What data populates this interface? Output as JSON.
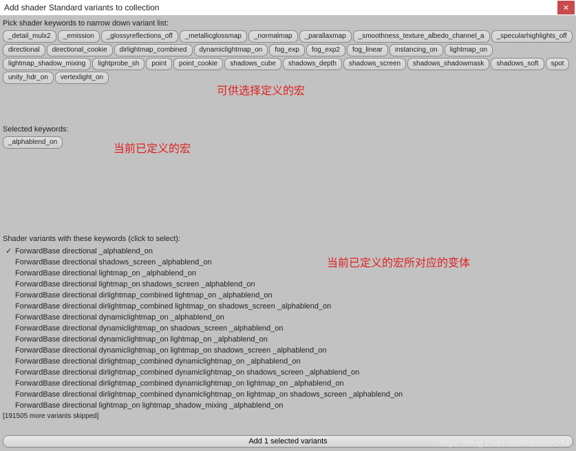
{
  "window": {
    "title": "Add shader Standard variants to collection"
  },
  "pick_section": {
    "label": "Pick shader keywords to narrow down variant list:",
    "keywords": [
      "_detail_mulx2",
      "_emission",
      "_glossyreflections_off",
      "_metallicglossmap",
      "_normalmap",
      "_parallaxmap",
      "_smoothness_texture_albedo_channel_a",
      "_specularhighlights_off",
      "directional",
      "directional_cookie",
      "dirlightmap_combined",
      "dynamiclightmap_on",
      "fog_exp",
      "fog_exp2",
      "fog_linear",
      "instancing_on",
      "lightmap_on",
      "lightmap_shadow_mixing",
      "lightprobe_sh",
      "point",
      "point_cookie",
      "shadows_cube",
      "shadows_depth",
      "shadows_screen",
      "shadows_shadowmask",
      "shadows_soft",
      "spot",
      "unity_hdr_on",
      "vertexlight_on"
    ]
  },
  "selected_section": {
    "label": "Selected keywords:",
    "keywords": [
      "_alphablend_on"
    ]
  },
  "variants_section": {
    "label": "Shader variants with these keywords (click to select):",
    "variants": [
      {
        "text": "ForwardBase directional _alphablend_on",
        "selected": true
      },
      {
        "text": "ForwardBase directional shadows_screen _alphablend_on",
        "selected": false
      },
      {
        "text": "ForwardBase directional lightmap_on _alphablend_on",
        "selected": false
      },
      {
        "text": "ForwardBase directional lightmap_on shadows_screen _alphablend_on",
        "selected": false
      },
      {
        "text": "ForwardBase directional dirlightmap_combined lightmap_on _alphablend_on",
        "selected": false
      },
      {
        "text": "ForwardBase directional dirlightmap_combined lightmap_on shadows_screen _alphablend_on",
        "selected": false
      },
      {
        "text": "ForwardBase directional dynamiclightmap_on _alphablend_on",
        "selected": false
      },
      {
        "text": "ForwardBase directional dynamiclightmap_on shadows_screen _alphablend_on",
        "selected": false
      },
      {
        "text": "ForwardBase directional dynamiclightmap_on lightmap_on _alphablend_on",
        "selected": false
      },
      {
        "text": "ForwardBase directional dynamiclightmap_on lightmap_on shadows_screen _alphablend_on",
        "selected": false
      },
      {
        "text": "ForwardBase directional dirlightmap_combined dynamiclightmap_on _alphablend_on",
        "selected": false
      },
      {
        "text": "ForwardBase directional dirlightmap_combined dynamiclightmap_on shadows_screen _alphablend_on",
        "selected": false
      },
      {
        "text": "ForwardBase directional dirlightmap_combined dynamiclightmap_on lightmap_on _alphablend_on",
        "selected": false
      },
      {
        "text": "ForwardBase directional dirlightmap_combined dynamiclightmap_on lightmap_on shadows_screen _alphablend_on",
        "selected": false
      },
      {
        "text": "ForwardBase directional lightmap_on lightmap_shadow_mixing _alphablend_on",
        "selected": false
      }
    ],
    "skipped": "[191505 more variants skipped]"
  },
  "annotations": {
    "a1": "可供选择定义的宏",
    "a2": "当前已定义的宏",
    "a3": "当前已定义的宏所对应的变体"
  },
  "footer": {
    "add_button": "Add 1 selected variants"
  },
  "watermark": "https://blog.csdn.net/RandomXM"
}
